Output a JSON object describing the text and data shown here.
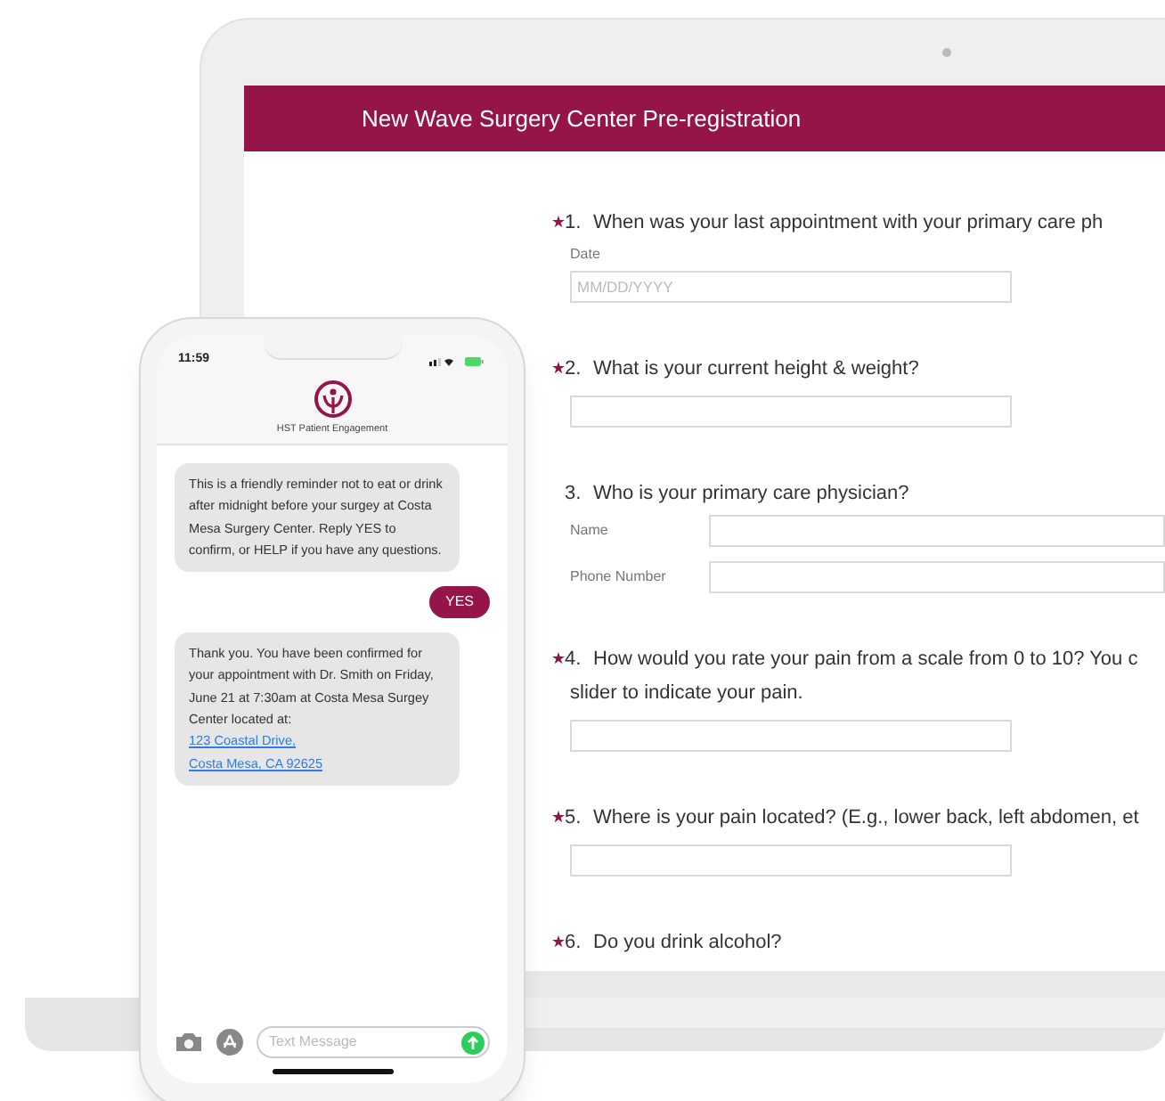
{
  "laptop": {
    "header": {
      "title": "New Wave Surgery Center Pre-registration"
    },
    "questions": [
      {
        "required": true,
        "number": "1.",
        "lines": [
          "When was your last appointment with your primary care ph"
        ],
        "fields": [
          {
            "kind": "stacked",
            "label": "Date",
            "placeholder": "MM/DD/YYYY"
          }
        ]
      },
      {
        "required": true,
        "number": "2.",
        "lines": [
          "What is your current height & weight?"
        ],
        "fields": [
          {
            "kind": "plain"
          }
        ]
      },
      {
        "required": false,
        "number": "3.",
        "lines": [
          "Who is your primary care physician?"
        ],
        "fields": [
          {
            "kind": "inline",
            "label": "Name"
          },
          {
            "kind": "inline",
            "label": "Phone Number"
          }
        ]
      },
      {
        "required": true,
        "number": "4.",
        "lines": [
          "How would you rate your pain from a scale from 0 to 10? You c",
          "slider to indicate your pain."
        ],
        "fields": [
          {
            "kind": "plain"
          }
        ]
      },
      {
        "required": true,
        "number": "5.",
        "lines": [
          "Where is your pain located? (E.g., lower back, left abdomen, et"
        ],
        "fields": [
          {
            "kind": "plain"
          }
        ]
      },
      {
        "required": true,
        "number": "6.",
        "lines": [
          "Do you drink alcohol?"
        ]
      }
    ]
  },
  "phone": {
    "status_bar": {
      "time": "11:59"
    },
    "contact": {
      "name": "HST Patient Engagement"
    },
    "messages": [
      {
        "kind": "incoming",
        "text": "This is a friendly reminder not to eat or drink after midnight before your surgey at Costa Mesa Surgery Center. Reply YES to confirm, or HELP if you have any questions."
      },
      {
        "kind": "outgoing",
        "text": "YES"
      },
      {
        "kind": "incoming",
        "text": "Thank you. You have been confirmed for your appointment with Dr. Smith on Friday, June 21 at 7:30am at Costa Mesa Surgey Center located at:",
        "links": [
          "123 Coastal Drive,",
          "Costa Mesa, CA 92625"
        ]
      }
    ],
    "composer": {
      "placeholder": "Text Message"
    }
  }
}
